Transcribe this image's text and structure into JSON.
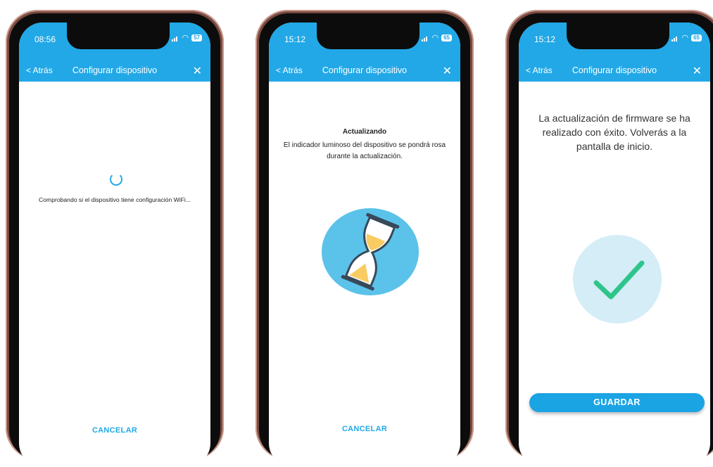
{
  "phones": [
    {
      "status": {
        "time": "08:56",
        "battery": "57"
      },
      "nav": {
        "back": "< Atrás",
        "title": "Configurar dispositivo",
        "close": "✕"
      },
      "message": "Comprobando si el dispositivo tiene configuración WiFi...",
      "cancel": "CANCELAR"
    },
    {
      "status": {
        "time": "15:12",
        "battery": "65"
      },
      "nav": {
        "back": "< Atrás",
        "title": "Configurar dispositivo",
        "close": "✕"
      },
      "title": "Actualizando",
      "description": "El indicador luminoso del dispositivo se pondrá rosa durante la actualización.",
      "cancel": "CANCELAR"
    },
    {
      "status": {
        "time": "15:12",
        "battery": "65"
      },
      "nav": {
        "back": "< Atrás",
        "title": "Configurar dispositivo",
        "close": "✕"
      },
      "message": "La actualización de firmware se ha realizado con éxito. Volverás a la pantalla de inicio.",
      "save": "GUARDAR"
    }
  ],
  "colors": {
    "accent": "#22a8e6",
    "success": "#2fc58a",
    "success_bg": "#d4edf7",
    "hourglass_bg": "#5bc2ea",
    "sand": "#f8cc62"
  }
}
